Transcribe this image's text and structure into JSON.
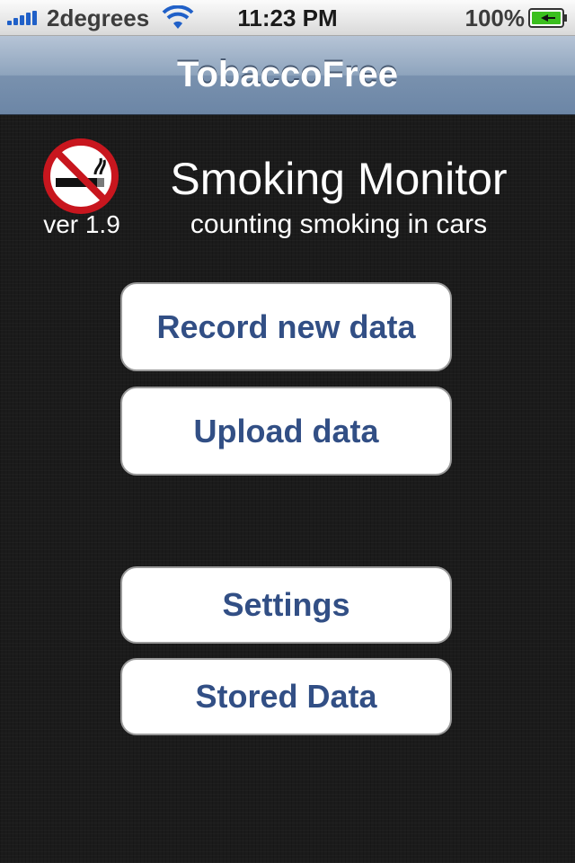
{
  "status_bar": {
    "carrier": "2degrees",
    "time": "11:23 PM",
    "battery": "100%"
  },
  "nav": {
    "title": "TobaccoFree"
  },
  "header": {
    "title": "Smoking Monitor",
    "subtitle": "counting smoking in cars",
    "version": "ver 1.9"
  },
  "buttons": {
    "record": "Record new data",
    "upload": "Upload data",
    "settings": "Settings",
    "stored": "Stored Data"
  },
  "colors": {
    "button_text": "#324f85",
    "nav_bar": "#7991ae",
    "background": "#1c1c1c",
    "no_smoking_red": "#c8161e"
  },
  "icons": [
    "signal-icon",
    "wifi-icon",
    "battery-icon",
    "no-smoking-icon"
  ]
}
